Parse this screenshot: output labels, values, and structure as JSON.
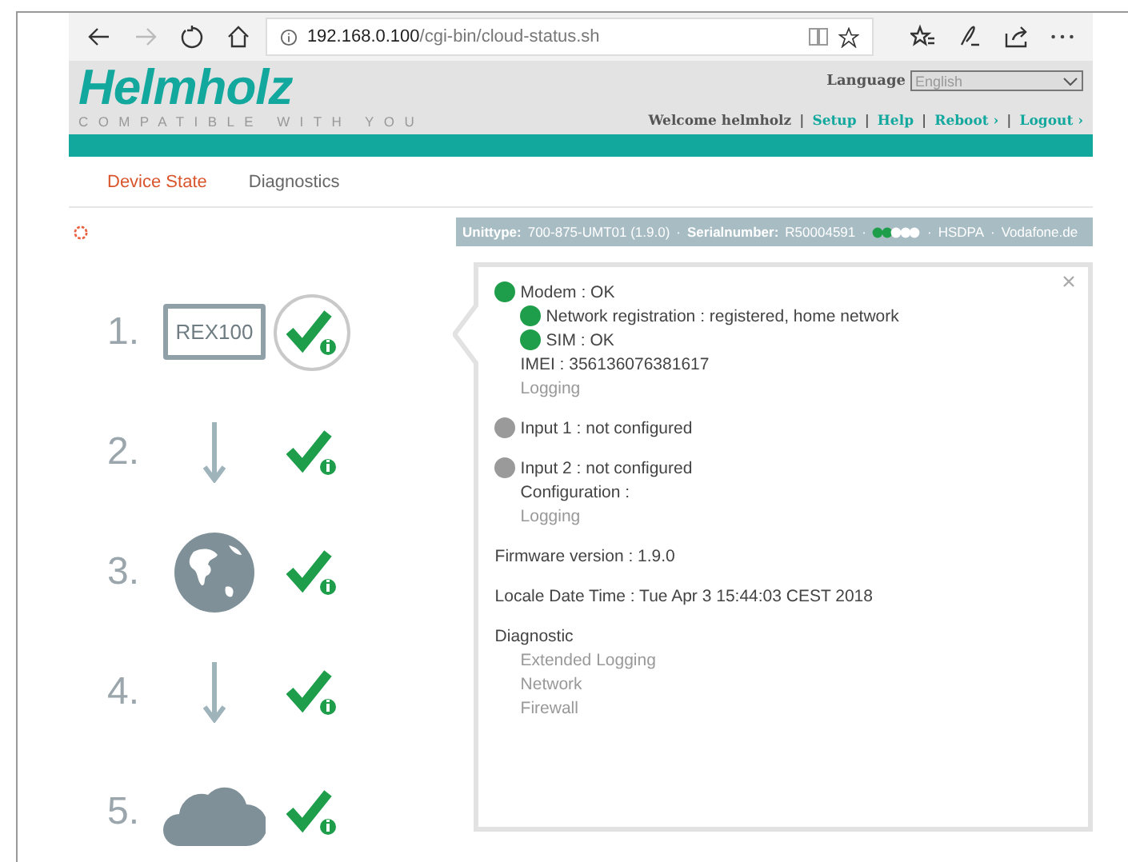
{
  "browser": {
    "url_host": "192.168.0.100",
    "url_path": "/cgi-bin/cloud-status.sh",
    "forward_disabled": true
  },
  "header": {
    "logo": "Helmholz",
    "tagline": "COMPATIBLE WITH YOU",
    "language_label": "Language",
    "language_value": "English",
    "welcome": "Welcome helmholz",
    "links": [
      "Setup",
      "Help",
      "Reboot ›",
      "Logout ›"
    ],
    "link_separator": "|"
  },
  "tabs": [
    {
      "label": "Device State",
      "selected": true
    },
    {
      "label": "Diagnostics",
      "selected": false
    }
  ],
  "status_bar": {
    "unittype_label": "Unittype:",
    "unittype": "700-875-UMT01 (1.9.0)",
    "serial_label": "Serialnumber:",
    "serial": "R50004591",
    "network": "HSDPA",
    "provider": "Vodafone.de",
    "separator": "·"
  },
  "steps": [
    {
      "number": "1.",
      "kind": "device",
      "label": "REX100",
      "selected": true
    },
    {
      "number": "2.",
      "kind": "arrow",
      "selected": false
    },
    {
      "number": "3.",
      "kind": "globe",
      "selected": false
    },
    {
      "number": "4.",
      "kind": "arrow",
      "selected": false
    },
    {
      "number": "5.",
      "kind": "cloud",
      "selected": false
    }
  ],
  "details": {
    "groups": [
      [
        {
          "kind": "status",
          "text": "Modem : OK",
          "color": "#1e9e4a",
          "children": [
            {
              "kind": "status",
              "text": "Network registration : registered, home network",
              "color": "#1e9e4a"
            },
            {
              "kind": "status",
              "text": "SIM : OK",
              "color": "#1e9e4a"
            },
            {
              "kind": "text",
              "text": "IMEI : 356136076381617"
            },
            {
              "kind": "link",
              "text": "Logging"
            }
          ]
        }
      ],
      [
        {
          "kind": "status",
          "text": "Input 1 : not configured",
          "color": "#9a9a9a"
        }
      ],
      [
        {
          "kind": "status",
          "text": "Input 2 : not configured",
          "color": "#9a9a9a",
          "children": [
            {
              "kind": "text",
              "text": "Configuration :"
            },
            {
              "kind": "link",
              "text": "Logging"
            }
          ]
        }
      ],
      [
        {
          "kind": "text",
          "text": "Firmware version : 1.9.0"
        }
      ],
      [
        {
          "kind": "text",
          "text": "Locale Date Time : Tue Apr 3 15:44:03 CEST 2018"
        }
      ],
      [
        {
          "kind": "text",
          "text": "Diagnostic",
          "children": [
            {
              "kind": "link",
              "text": "Extended Logging"
            },
            {
              "kind": "link",
              "text": "Network"
            },
            {
              "kind": "link",
              "text": "Firewall"
            }
          ]
        }
      ]
    ]
  }
}
